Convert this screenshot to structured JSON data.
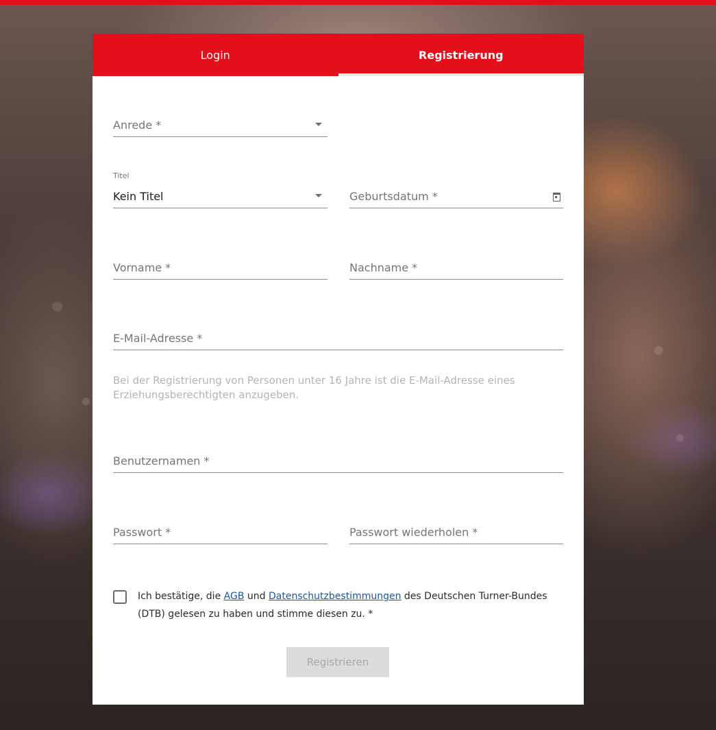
{
  "colors": {
    "brand_red": "#e3101b",
    "link_blue": "#1a56a6",
    "field_line": "#8a8a8a",
    "hint_text": "#b4b4b4"
  },
  "tabs": [
    {
      "label": "Login",
      "active": false
    },
    {
      "label": "Registrierung",
      "active": true
    }
  ],
  "form": {
    "anrede": {
      "placeholder": "Anrede *",
      "icon": "chevron-down-icon"
    },
    "titel": {
      "label": "Titel",
      "value": "Kein Titel",
      "icon": "chevron-down-icon"
    },
    "geburtsdatum": {
      "placeholder": "Geburtsdatum *",
      "icon": "calendar-icon"
    },
    "vorname": {
      "placeholder": "Vorname *"
    },
    "nachname": {
      "placeholder": "Nachname *"
    },
    "email": {
      "placeholder": "E-Mail-Adresse *"
    },
    "email_hint": "Bei der Registrierung von Personen unter 16 Jahre ist die E-Mail-Adresse eines Erziehungsberechtigten anzugeben.",
    "benutzername": {
      "placeholder": "Benutzernamen *"
    },
    "passwort": {
      "placeholder": "Passwort *"
    },
    "passwort_wiederholen": {
      "placeholder": "Passwort wiederholen *"
    },
    "consent": {
      "checked": false,
      "text_before": "Ich bestätige, die ",
      "link_agb": "AGB",
      "text_middle": " und ",
      "link_datenschutz": "Datenschutzbestimmungen",
      "text_after": " des Deutschen Turner-Bundes (DTB) gelesen zu haben und stimme diesen zu. *"
    },
    "submit_label": "Registrieren",
    "submit_enabled": false
  }
}
